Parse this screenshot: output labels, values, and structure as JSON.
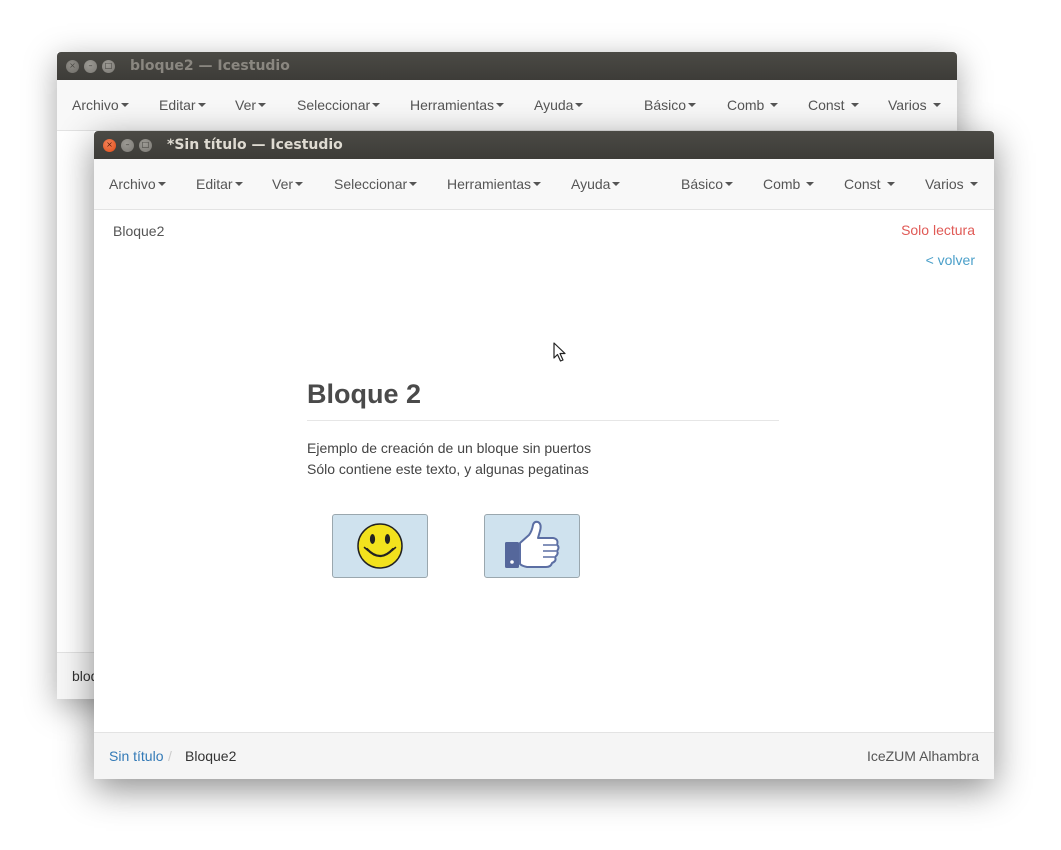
{
  "back_window": {
    "title": "bloque2 — Icestudio",
    "menu": {
      "left": [
        "Archivo",
        "Editar",
        "Ver",
        "Seleccionar",
        "Herramientas",
        "Ayuda"
      ],
      "right": [
        "Básico",
        "Comb",
        "Const",
        "Varios"
      ]
    },
    "footer_text": "bloq"
  },
  "front_window": {
    "title": "*Sin título — Icestudio",
    "menu": {
      "left": [
        "Archivo",
        "Editar",
        "Ver",
        "Seleccionar",
        "Herramientas",
        "Ayuda"
      ],
      "right": [
        "Básico",
        "Comb",
        "Const",
        "Varios"
      ]
    },
    "header_crumb": "Bloque2",
    "read_only": "Solo lectura",
    "back_link": "< volver",
    "block": {
      "title": "Bloque 2",
      "description_line1": "Ejemplo de creación de un bloque sin puertos",
      "description_line2": "Sólo contiene este texto, y algunas pegatinas",
      "stickers": [
        {
          "icon": "smiley-face-icon"
        },
        {
          "icon": "thumbs-up-icon"
        }
      ]
    },
    "footer": {
      "breadcrumb_root": "Sin título",
      "separator": "/",
      "breadcrumb_current": "Bloque2",
      "board": "IceZUM Alhambra"
    }
  },
  "colors": {
    "titlebar": "#3d3c38",
    "close_button": "#df4b16",
    "read_only": "#e05a56",
    "link": "#4a9fc9",
    "sticker_bg": "#cfe2ee"
  }
}
